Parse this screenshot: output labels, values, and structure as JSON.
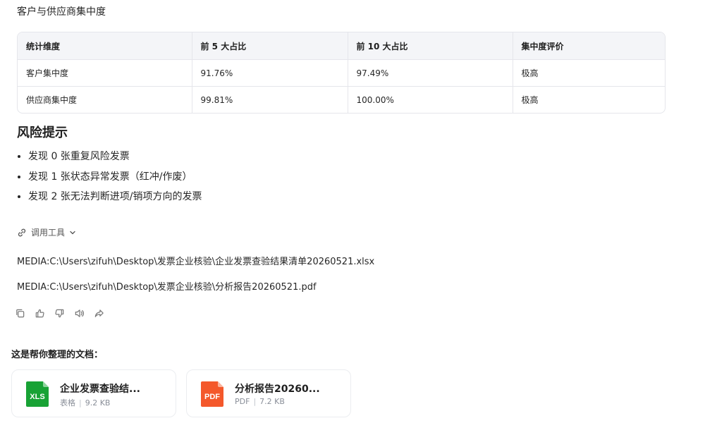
{
  "intro": "客户与供应商集中度",
  "table": {
    "headers": [
      "统计维度",
      "前 5 大占比",
      "前 10 大占比",
      "集中度评价"
    ],
    "rows": [
      [
        "客户集中度",
        "91.76%",
        "97.49%",
        "极高"
      ],
      [
        "供应商集中度",
        "99.81%",
        "100.00%",
        "极高"
      ]
    ]
  },
  "risk": {
    "title": "风险提示",
    "items": [
      "发现 0 张重复风险发票",
      "发现 1 张状态异常发票（红冲/作废）",
      "发现 2 张无法判断进项/销项方向的发票"
    ]
  },
  "tool_call": {
    "label": "调用工具",
    "icons": [
      "link-icon",
      "chevron-down-icon"
    ]
  },
  "media": [
    "MEDIA:C:\\Users\\zifuh\\Desktop\\发票企业核验\\企业发票查验结果清单20260521.xlsx",
    "MEDIA:C:\\Users\\zifuh\\Desktop\\发票企业核验\\分析报告20260521.pdf"
  ],
  "actions": [
    "copy-icon",
    "thumbs-up-icon",
    "thumbs-down-icon",
    "speaker-icon",
    "share-icon"
  ],
  "docs": {
    "title": "这是帮你整理的文档：",
    "files": [
      {
        "name": "企业发票查验结...",
        "badge": "XLS",
        "type": "表格",
        "size": "9.2 KB",
        "color": "#18a235"
      },
      {
        "name": "分析报告20260...",
        "badge": "PDF",
        "type": "PDF",
        "size": "7.2 KB",
        "color": "#f4582b"
      }
    ]
  },
  "colors": {
    "table_header_bg": "#f4f5f8",
    "border": "#e5e6eb",
    "xls_green": "#18a235",
    "pdf_orange": "#f4582b"
  }
}
